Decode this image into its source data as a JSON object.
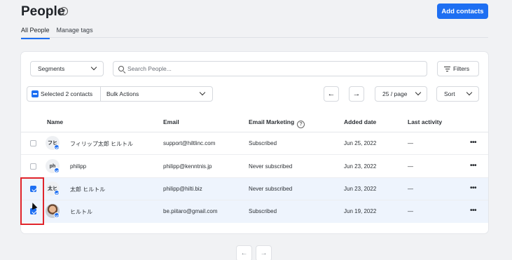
{
  "header": {
    "title": "People",
    "help_icon": "question-circle-icon",
    "add_contacts_label": "Add contacts",
    "accent_color": "#1e6ff2"
  },
  "tabs": [
    {
      "label": "All People",
      "active": true
    },
    {
      "label": "Manage tags",
      "active": false
    }
  ],
  "toolbar": {
    "segments_label": "Segments",
    "search_placeholder": "Search People...",
    "filters_label": "Filters",
    "selected_label": "Selected 2 contacts",
    "bulk_actions_label": "Bulk Actions",
    "prev_arrow": "←",
    "next_arrow": "→",
    "per_page_label": "25 / page",
    "sort_label": "Sort"
  },
  "table": {
    "columns": [
      "Name",
      "Email",
      "Email Marketing",
      "Added date",
      "Last activity"
    ],
    "rows": [
      {
        "initials": "フヒ",
        "name": "フィリップ太郎 ヒルトル",
        "email": "support@hiltlinc.com",
        "marketing": "Subscribed",
        "added": "Jun 25, 2022",
        "activity": "—",
        "checked": false
      },
      {
        "initials": "ph",
        "name": "philipp",
        "email": "philipp@kenntnis.jp",
        "marketing": "Never subscribed",
        "added": "Jun 23, 2022",
        "activity": "—",
        "checked": false
      },
      {
        "initials": "太ヒ",
        "name": "太郎 ヒルトル",
        "email": "philipp@hilti.biz",
        "marketing": "Never subscribed",
        "added": "Jun 23, 2022",
        "activity": "—",
        "checked": true
      },
      {
        "initials": "",
        "name": "ヒルトル",
        "email": "be.piitaro@gmail.com",
        "marketing": "Subscribed",
        "added": "Jun 19, 2022",
        "activity": "—",
        "checked": true
      }
    ],
    "more_label": "•••"
  },
  "pagination": {
    "prev": "←",
    "next": "→"
  }
}
